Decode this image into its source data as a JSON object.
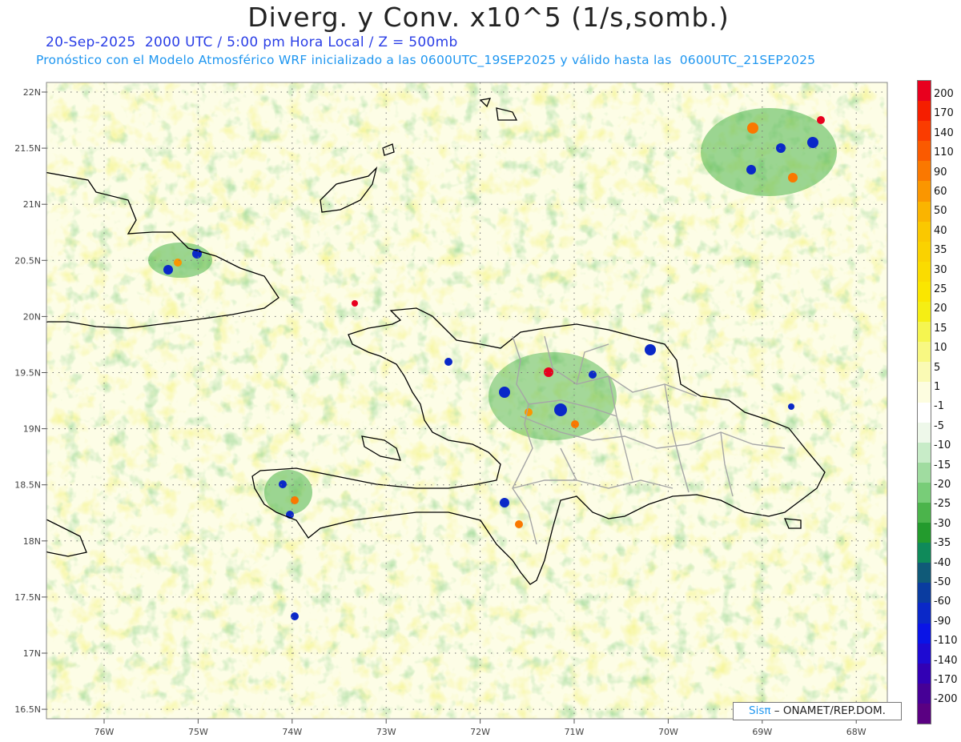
{
  "title": "Diverg. y Conv. x10^5 (1/s,somb.)",
  "subtitle_date": "20-Sep-2025  2000 UTC / 5:00 pm Hora Local / Z = 500mb",
  "subtitle_model": "Pronóstico con el Modelo Atmosférico WRF inicializado a las 0600UTC_19SEP2025 y válido hasta las  0600UTC_21SEP2025",
  "lat_labels": [
    "22N",
    "21.5N",
    "21N",
    "20.5N",
    "20N",
    "19.5N",
    "19N",
    "18.5N",
    "18N",
    "17.5N",
    "17N",
    "16.5N"
  ],
  "lon_labels": [
    "76W",
    "75W",
    "74W",
    "73W",
    "72W",
    "71W",
    "70W",
    "69W",
    "68W"
  ],
  "colorbar": {
    "labels": [
      "200",
      "170",
      "140",
      "110",
      "90",
      "60",
      "50",
      "40",
      "35",
      "30",
      "25",
      "20",
      "15",
      "10",
      "5",
      "1",
      "-1",
      "-5",
      "-10",
      "-15",
      "-20",
      "-25",
      "-30",
      "-35",
      "-40",
      "-50",
      "-60",
      "-90",
      "-110",
      "-140",
      "-170",
      "-200"
    ],
    "colors": [
      "#e8001e",
      "#f51e00",
      "#fa3c00",
      "#fa5a00",
      "#fa7800",
      "#fa9600",
      "#fab400",
      "#fac800",
      "#fad200",
      "#fadc00",
      "#fae600",
      "#f5ee14",
      "#f5f550",
      "#f8f882",
      "#fafab4",
      "#fdfde0",
      "#ffffff",
      "#eef8ea",
      "#c8ecc8",
      "#a0dca0",
      "#78cd78",
      "#4bb44b",
      "#239b2d",
      "#0f8a5a",
      "#105a78",
      "#0a3ca0",
      "#0a28c8",
      "#0a14e6",
      "#1e0ad2",
      "#3200b4",
      "#460096",
      "#5a0082"
    ]
  },
  "credit": {
    "brand": "Sisπ",
    "org": " – ONAMET/REP.DOM."
  }
}
